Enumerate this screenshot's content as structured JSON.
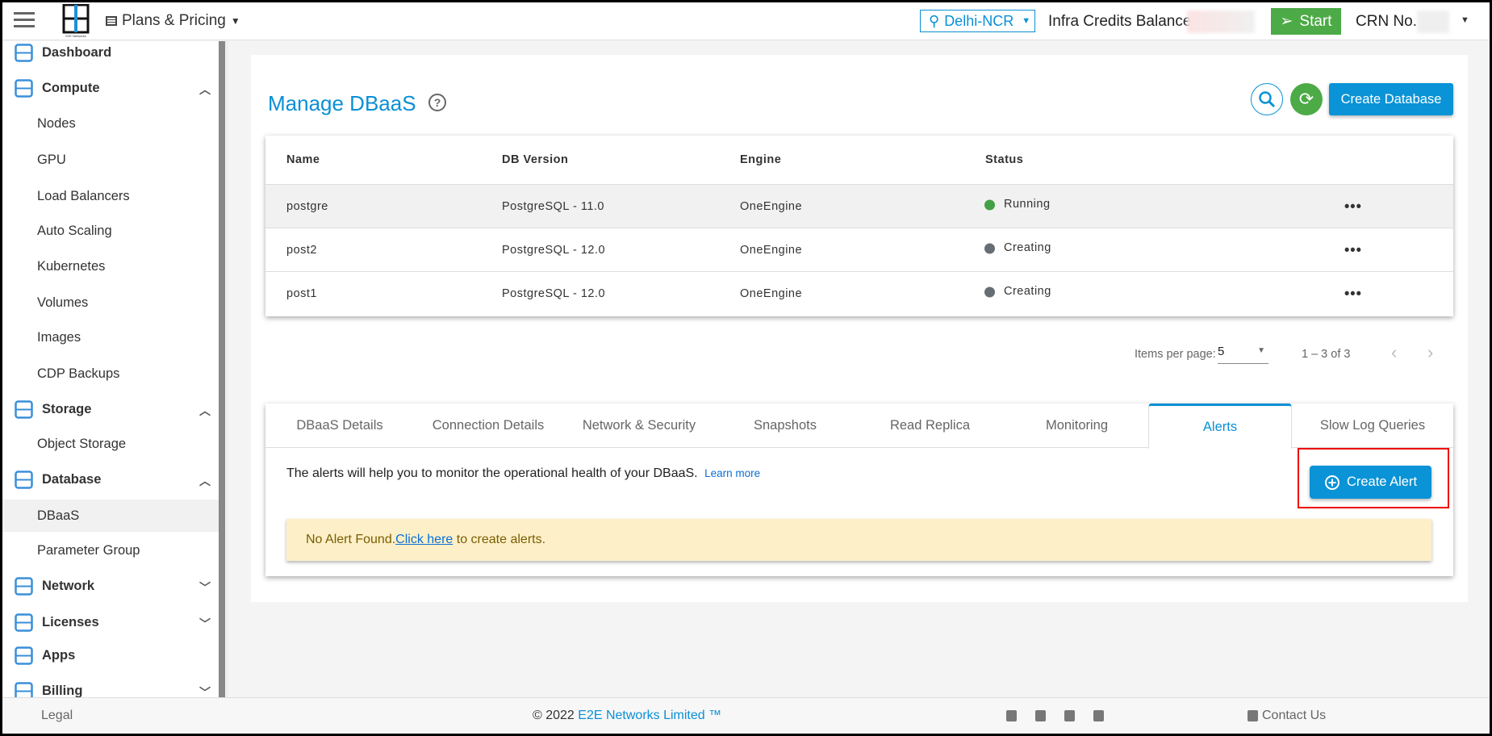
{
  "header": {
    "plans_label": "Plans & Pricing",
    "region": "Delhi-NCR",
    "credits_label": "Infra Credits Balance",
    "start_label": "Start",
    "crn_label": "CRN No.",
    "logo_text": "E2E Networks"
  },
  "sidebar": {
    "items": [
      {
        "label": "Dashboard",
        "type": "head",
        "icon": "dashboard-icon"
      },
      {
        "label": "Compute",
        "type": "head",
        "icon": "server-icon",
        "chevron": "up"
      },
      {
        "label": "Nodes",
        "type": "sub"
      },
      {
        "label": "GPU",
        "type": "sub"
      },
      {
        "label": "Load Balancers",
        "type": "sub"
      },
      {
        "label": "Auto Scaling",
        "type": "sub"
      },
      {
        "label": "Kubernetes",
        "type": "sub"
      },
      {
        "label": "Volumes",
        "type": "sub"
      },
      {
        "label": "Images",
        "type": "sub"
      },
      {
        "label": "CDP Backups",
        "type": "sub"
      },
      {
        "label": "Storage",
        "type": "head",
        "icon": "database-icon",
        "chevron": "up"
      },
      {
        "label": "Object Storage",
        "type": "sub"
      },
      {
        "label": "Database",
        "type": "head",
        "icon": "cloud-icon",
        "chevron": "up"
      },
      {
        "label": "DBaaS",
        "type": "sub",
        "active": true
      },
      {
        "label": "Parameter Group",
        "type": "sub"
      },
      {
        "label": "Network",
        "type": "head",
        "icon": "network-icon",
        "chevron": "down"
      },
      {
        "label": "Licenses",
        "type": "head",
        "icon": "licenses-icon",
        "chevron": "down"
      },
      {
        "label": "Apps",
        "type": "head",
        "icon": "rocket-icon"
      },
      {
        "label": "Billing",
        "type": "head",
        "icon": "billing-icon",
        "chevron": "down"
      }
    ]
  },
  "main": {
    "title": "Manage DBaaS",
    "create_database": "Create Database",
    "table": {
      "headers": [
        "Name",
        "DB Version",
        "Engine",
        "Status"
      ],
      "rows": [
        {
          "name": "postgre",
          "version": "PostgreSQL - 11.0",
          "engine": "OneEngine",
          "status": "Running",
          "status_color": "#43a047"
        },
        {
          "name": "post2",
          "version": "PostgreSQL - 12.0",
          "engine": "OneEngine",
          "status": "Creating",
          "status_color": "#666e75"
        },
        {
          "name": "post1",
          "version": "PostgreSQL - 12.0",
          "engine": "OneEngine",
          "status": "Creating",
          "status_color": "#666e75"
        }
      ]
    },
    "pagination": {
      "items_label": "Items per page:",
      "page_size": "5",
      "range": "1 – 3 of 3"
    },
    "tabs": [
      "DBaaS Details",
      "Connection Details",
      "Network & Security",
      "Snapshots",
      "Read Replica",
      "Monitoring",
      "Alerts",
      "Slow Log Queries"
    ],
    "active_tab": "Alerts",
    "alerts": {
      "description": "The alerts will help you to monitor the operational health of your DBaaS.",
      "learn_more": "Learn more",
      "create_alert": "Create Alert",
      "notice_prefix": "No Alert Found.",
      "notice_link": "Click here",
      "notice_suffix": " to create alerts."
    }
  },
  "footer": {
    "legal": "Legal",
    "copyright": "© 2022 ",
    "company": "E2E Networks Limited ™",
    "contact": "Contact Us"
  },
  "colors": {
    "accent": "#0a93d6",
    "start": "#4caa47",
    "highlight": "#ee0000"
  }
}
